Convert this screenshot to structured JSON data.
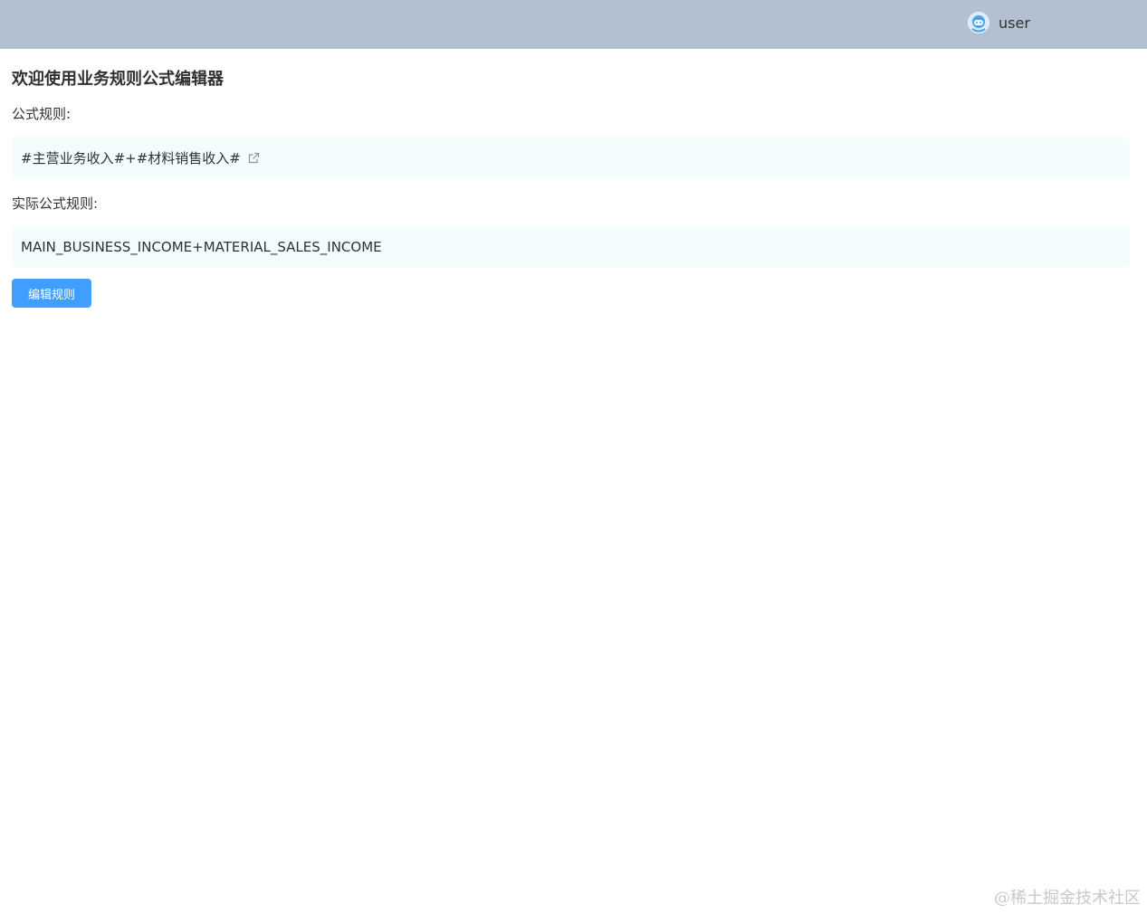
{
  "header": {
    "username": "user",
    "avatar_icon": "user-avatar-icon",
    "background_color": "#b3c0d1"
  },
  "main": {
    "title": "欢迎使用业务规则公式编辑器",
    "rule_label": "公式规则:",
    "rule_text": "#主营业务收入#+#材料销售收入#",
    "rule_edit_icon": "external-edit-icon",
    "actual_label": "实际公式规则:",
    "actual_text": "MAIN_BUSINESS_INCOME+MATERIAL_SALES_INCOME",
    "edit_button_label": "编辑规则",
    "box_color": "#f3fdfd",
    "accent_color": "#409eff"
  },
  "watermark": "@稀土掘金技术社区"
}
